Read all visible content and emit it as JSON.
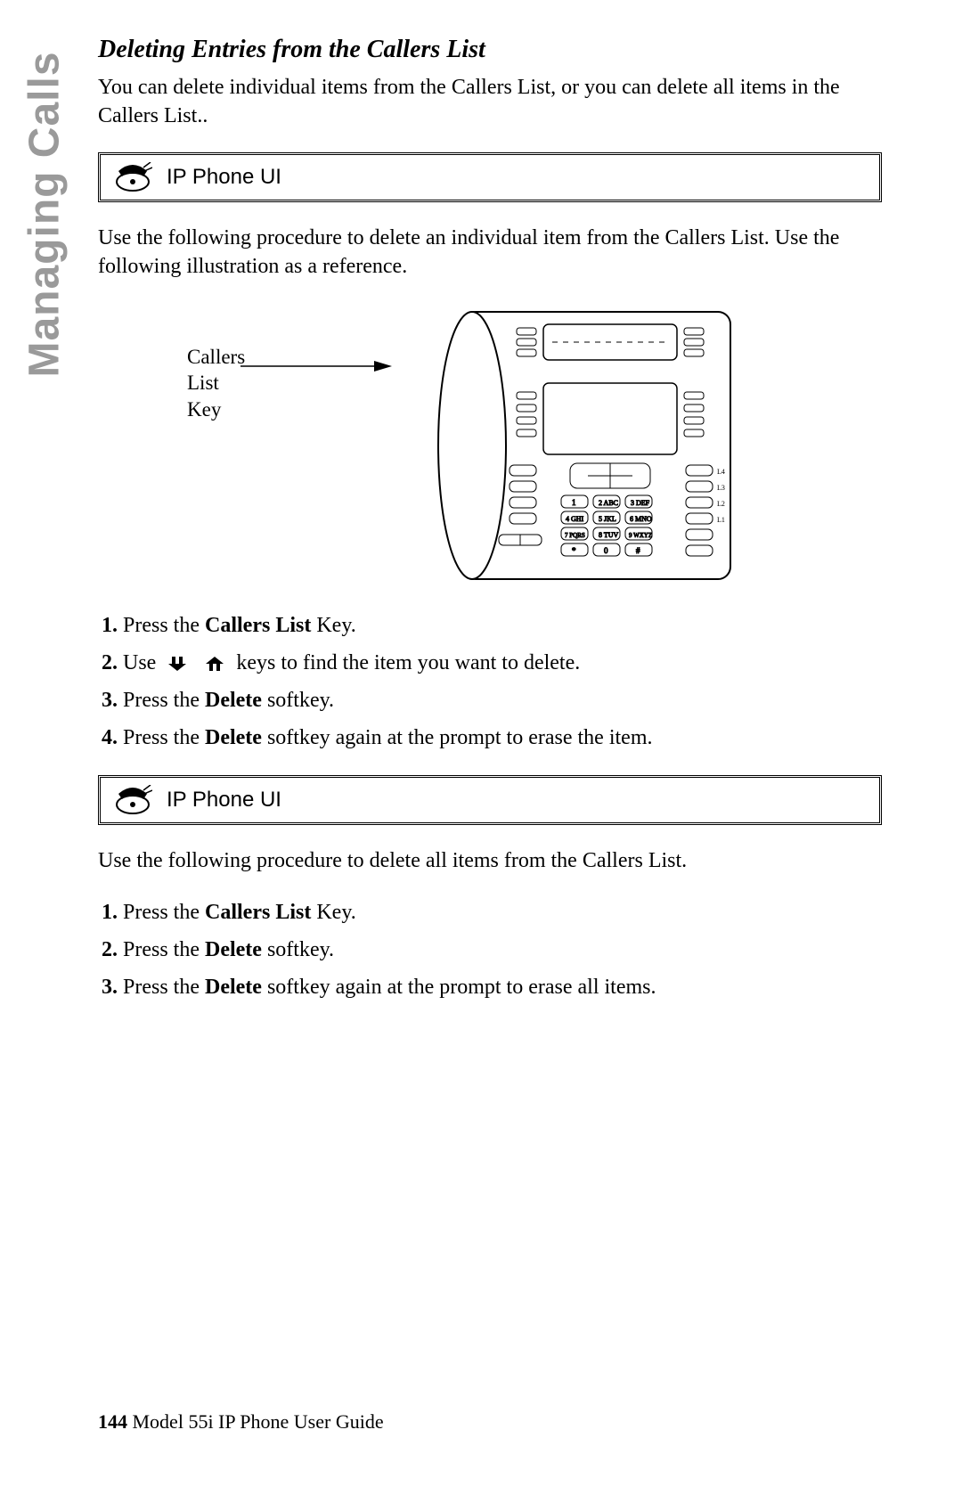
{
  "sideTab": "Managing Calls",
  "section": {
    "title": "Deleting Entries from the Callers List",
    "intro": "You can delete individual items from the Callers List, or you can delete all items in the Callers List.."
  },
  "uiBox1": {
    "label": "IP Phone UI"
  },
  "procedure1": {
    "intro": "Use the following procedure to delete an individual item from the Callers List. Use the following illustration as a reference.",
    "callout": "Callers List\nKey",
    "steps": {
      "s1_pre": "Press the ",
      "s1_bold": "Callers List",
      "s1_post": " Key.",
      "s2_pre": "Use ",
      "s2_post": " keys to find the item you want to delete.",
      "s3_pre": "Press the ",
      "s3_bold": "Delete",
      "s3_post": " softkey.",
      "s4_pre": "Press the ",
      "s4_bold": "Delete",
      "s4_post": " softkey again at the prompt to erase the item."
    }
  },
  "uiBox2": {
    "label": "IP Phone UI"
  },
  "procedure2": {
    "intro": "Use the following procedure to delete all items from the Callers List.",
    "steps": {
      "s1_pre": "Press the ",
      "s1_bold": "Callers List",
      "s1_post": " Key.",
      "s2_pre": "Press the ",
      "s2_bold": "Delete",
      "s2_post": " softkey.",
      "s3_pre": "Press the ",
      "s3_bold": "Delete",
      "s3_post": " softkey again at the prompt to erase all items."
    }
  },
  "footer": {
    "page": "144",
    "title": " Model 55i IP Phone User Guide"
  }
}
